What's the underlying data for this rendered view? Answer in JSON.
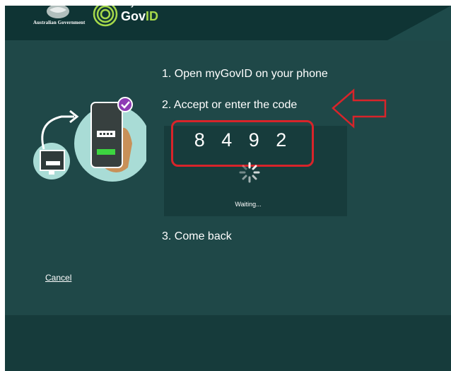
{
  "header": {
    "government_label": "Australian Government",
    "brand_top": "my",
    "brand_main": "Gov",
    "brand_accent": "ID"
  },
  "steps": {
    "step1": "1. Open myGovID on your phone",
    "step2": "2. Accept or enter the code",
    "step3": "3. Come back"
  },
  "code": "8 4 9 2",
  "status": "Waiting...",
  "cancel_label": "Cancel",
  "colors": {
    "background": "#1f4848",
    "header": "#0f3434",
    "panel": "#173c3c",
    "accent_green": "#a6d94b",
    "highlight_red": "#d8242a",
    "check_purple": "#8e3bb5"
  },
  "icons": [
    "coat-of-arms-icon",
    "mygovid-logo-icon",
    "phone-illustration-icon",
    "loading-spinner-icon",
    "red-arrow-annotation"
  ]
}
